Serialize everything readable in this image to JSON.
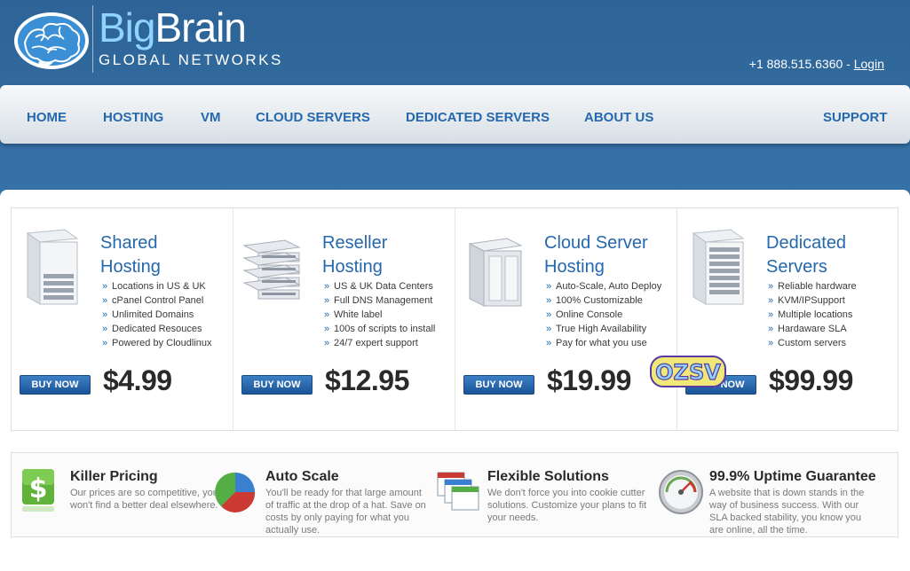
{
  "header": {
    "brand_part1": "Big",
    "brand_part2": "Brain",
    "brand_sub": "GLOBAL NETWORKS",
    "phone": "+1 888.515.6360",
    "separator": " - ",
    "login": "Login"
  },
  "nav": {
    "items": [
      "HOME",
      "HOSTING",
      "VM",
      "CLOUD SERVERS",
      "DEDICATED SERVERS",
      "ABOUT US"
    ],
    "support": "SUPPORT"
  },
  "products": [
    {
      "title_line1": "Shared",
      "title_line2": "Hosting",
      "features": [
        "Locations in US & UK",
        "cPanel Control Panel",
        "Unlimited Domains",
        "Dedicated Resouces",
        "Powered by Cloudlinux"
      ],
      "buy_label": "BUY NOW",
      "price": "$4.99"
    },
    {
      "title_line1": "Reseller",
      "title_line2": "Hosting",
      "features": [
        "US & UK Data Centers",
        "Full DNS Management",
        "White label",
        "100s of scripts to install",
        "24/7 expert support"
      ],
      "buy_label": "BUY NOW",
      "price": "$12.95"
    },
    {
      "title_line1": "Cloud Server",
      "title_line2": "Hosting",
      "features": [
        "Auto-Scale, Auto Deploy",
        "100% Customizable",
        "Online Console",
        "True High Availability",
        "Pay for what you use"
      ],
      "buy_label": "BUY NOW",
      "price": "$19.99"
    },
    {
      "title_line1": "Dedicated",
      "title_line2": "Servers",
      "features": [
        "Reliable hardware",
        "KVM/IPSupport",
        "Multiple locations",
        "Hardaware SLA",
        "Custom servers"
      ],
      "buy_label": "BUY NOW",
      "price": "$99.99"
    }
  ],
  "features": [
    {
      "icon": "dollar-icon",
      "title": "Killer Pricing",
      "text": "Our prices are so competitive, you won't find a better deal elsewhere."
    },
    {
      "icon": "pie-chart-icon",
      "title": "Auto Scale",
      "text": "You'll be ready for that large amount of traffic at the drop of a hat. Save on costs by only paying for what you actually use."
    },
    {
      "icon": "windows-stack-icon",
      "title": "Flexible Solutions",
      "text": "We don't force you into cookie cutter solutions. Customize your plans to fit your needs."
    },
    {
      "icon": "speedometer-icon",
      "title": "99.9% Uptime Guarantee",
      "text": "A website that is down stands in the way of business success. With our SLA backed stability, you know you are online, all the time."
    }
  ],
  "sticker": "OZSV",
  "colors": {
    "brand_blue": "#2568ad",
    "header_bg": "#2d6396",
    "light_blue": "#8fd3ff"
  }
}
